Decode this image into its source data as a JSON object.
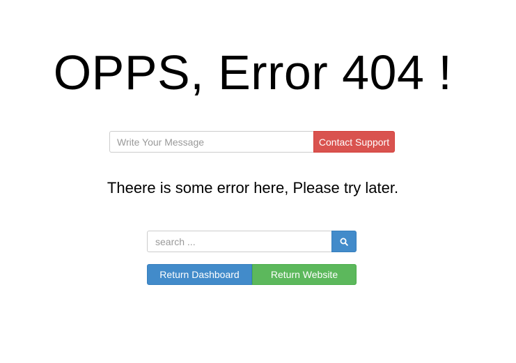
{
  "error": {
    "title": "OPPS, Error 404 !",
    "message": "Theere is some error here, Please try later."
  },
  "contact": {
    "placeholder": "Write Your Message",
    "value": "",
    "button_label": "Contact Support"
  },
  "search": {
    "placeholder": "search ...",
    "value": "",
    "icon": "search-icon"
  },
  "actions": {
    "dashboard_label": "Return Dashboard",
    "website_label": "Return Website"
  },
  "colors": {
    "danger": "#d9534f",
    "primary": "#428bca",
    "success": "#5cb85c"
  }
}
